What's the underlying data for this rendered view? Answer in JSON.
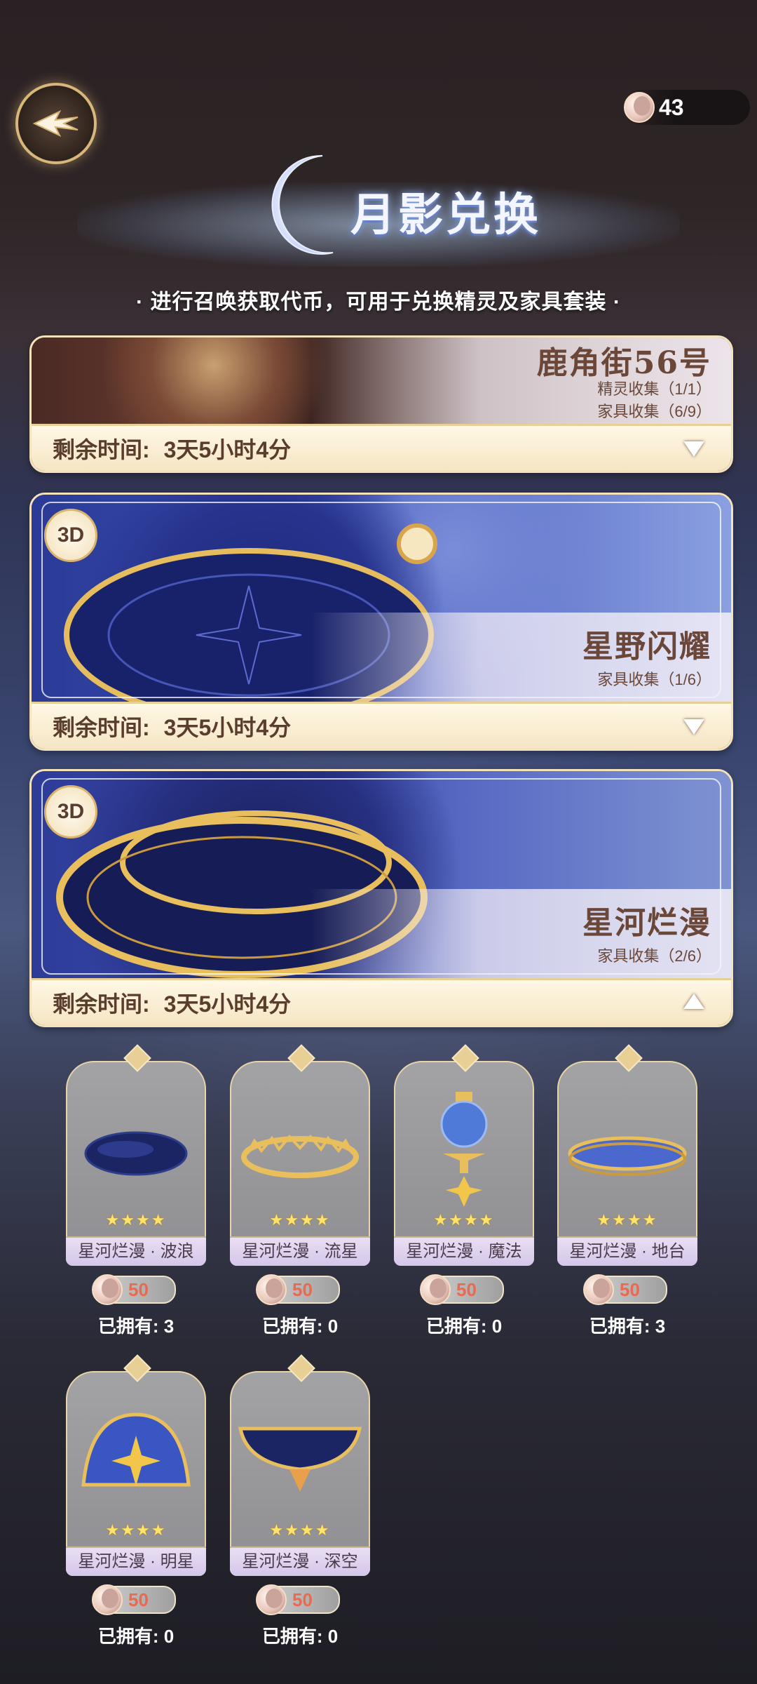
{
  "header": {
    "currency_value": "43",
    "title": "月影兑换",
    "subtitle": "· 进行召唤获取代币，可用于兑换精灵及家具套装 ·"
  },
  "cards": [
    {
      "name": "鹿角街56号",
      "lines": [
        "精灵收集（1/1）",
        "家具收集（6/9）"
      ],
      "timer_label": "剩余时间:",
      "timer_value": "3天5小时4分",
      "expanded": false
    },
    {
      "badge": "3D",
      "name": "星野闪耀",
      "lines": [
        "家具收集（1/6）"
      ],
      "timer_label": "剩余时间:",
      "timer_value": "3天5小时4分",
      "expanded": false
    },
    {
      "badge": "3D",
      "name": "星河烂漫",
      "lines": [
        "家具收集（2/6）"
      ],
      "timer_label": "剩余时间:",
      "timer_value": "3天5小时4分",
      "expanded": true
    }
  ],
  "items": [
    {
      "name": "星河烂漫 · 波浪",
      "stars": "★★★★",
      "price": "50",
      "owned": "已拥有: 3"
    },
    {
      "name": "星河烂漫 · 流星",
      "stars": "★★★★",
      "price": "50",
      "owned": "已拥有: 0"
    },
    {
      "name": "星河烂漫 · 魔法",
      "stars": "★★★★",
      "price": "50",
      "owned": "已拥有: 0"
    },
    {
      "name": "星河烂漫 · 地台",
      "stars": "★★★★",
      "price": "50",
      "owned": "已拥有: 3"
    },
    {
      "name": "星河烂漫 · 明星",
      "stars": "★★★★",
      "price": "50",
      "owned": "已拥有: 0"
    },
    {
      "name": "星河烂漫 · 深空",
      "stars": "★★★★",
      "price": "50",
      "owned": "已拥有: 0"
    }
  ]
}
